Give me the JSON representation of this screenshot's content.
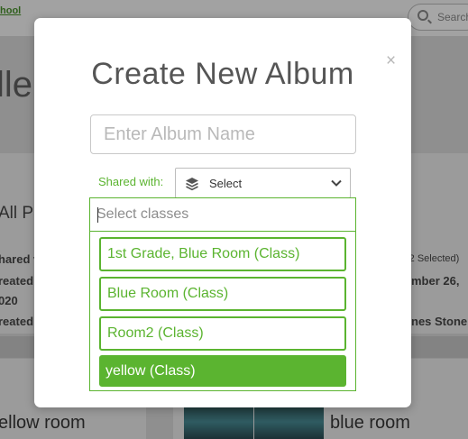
{
  "background": {
    "logo_text": "hool",
    "search_placeholder": "Search",
    "page_title": "ller",
    "left_card": {
      "title": "All Pa",
      "line1": "hared v",
      "line2": "reated:",
      "line3": "020",
      "line4": "reated"
    },
    "right_card": {
      "shared_count": "(2 Selected)",
      "date_text": "mber 26,",
      "creator_text": "nes Stone"
    },
    "bottom_albums": [
      "ellow room",
      "blue room"
    ]
  },
  "modal": {
    "title": "Create New Album",
    "close_label": "×",
    "album_name_placeholder": "Enter Album Name",
    "shared_with_label": "Shared with:",
    "select_label": "Select",
    "class_search_placeholder": "Select classes",
    "class_options": [
      {
        "label": "1st Grade, Blue Room (Class)",
        "selected": false
      },
      {
        "label": "Blue Room (Class)",
        "selected": false
      },
      {
        "label": "Room2 (Class)",
        "selected": false
      },
      {
        "label": "yellow (Class)",
        "selected": true
      }
    ]
  },
  "colors": {
    "accent_green": "#5bb430",
    "title_gray": "#555555",
    "overlay_gray": "#8f8f8f"
  },
  "icons": {
    "select_icon": "layers-icon",
    "dropdown_icon": "chevron-down-icon",
    "search_icon": "search-icon"
  }
}
